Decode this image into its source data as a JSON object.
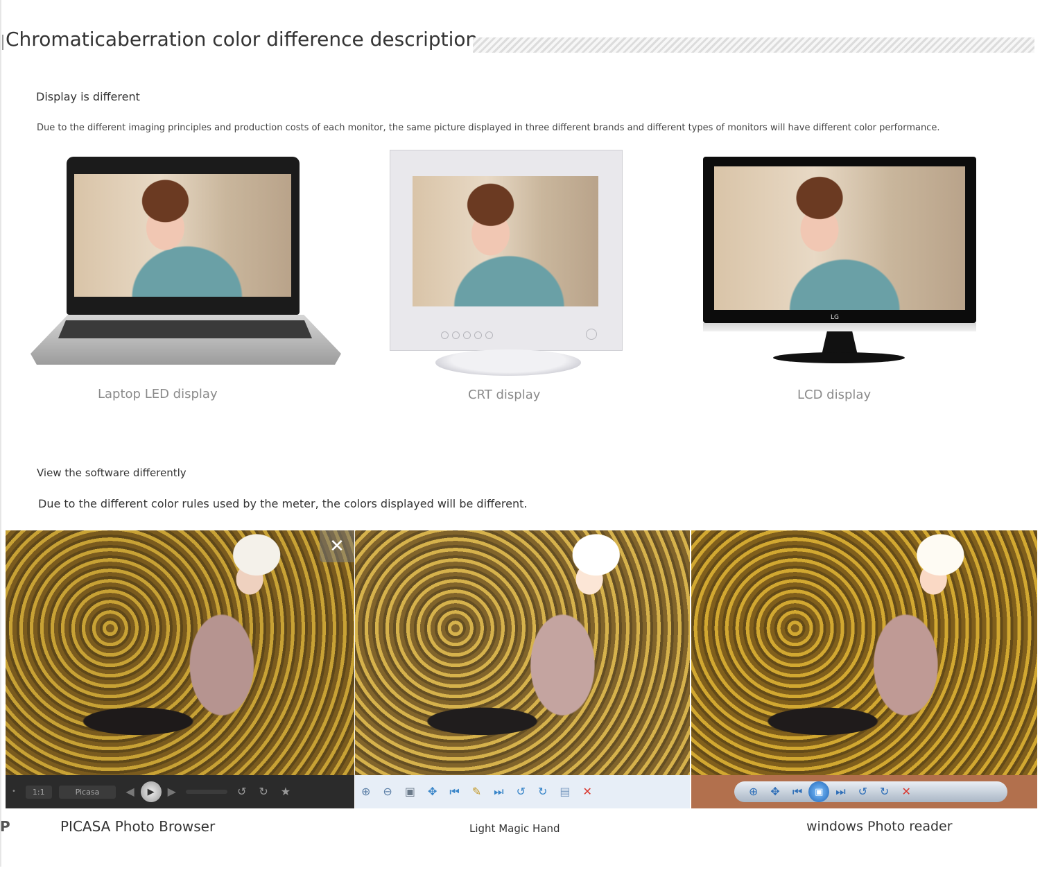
{
  "header": {
    "title": "Chromaticaberration color difference description"
  },
  "section_display": {
    "title": "Display is different",
    "description": "Due to the different imaging principles and production costs of each monitor, the same picture displayed in three different brands and different types of monitors will have different color performance.",
    "monitors": [
      {
        "label": "Laptop LED display"
      },
      {
        "label": "CRT display"
      },
      {
        "label": "LCD display"
      }
    ]
  },
  "section_software": {
    "title": "View the software differently",
    "description": "Due to the different color rules used by the meter, the colors displayed will be different.",
    "viewers": [
      {
        "label": "PICASA Photo Browser"
      },
      {
        "label": "Light Magic Hand"
      },
      {
        "label": "windows Photo reader"
      }
    ],
    "picasa_toolbar": {
      "zoom": "1:1",
      "name": "Picasa",
      "close": "✕"
    },
    "edge_letter": "P"
  },
  "brand": {
    "lcd_logo": "LG"
  },
  "icons": {
    "close": "close-icon",
    "play": "play-icon",
    "zoom_in": "zoom-in-icon",
    "zoom_out": "zoom-out-icon",
    "delete": "delete-icon",
    "rotate": "rotate-icon"
  }
}
